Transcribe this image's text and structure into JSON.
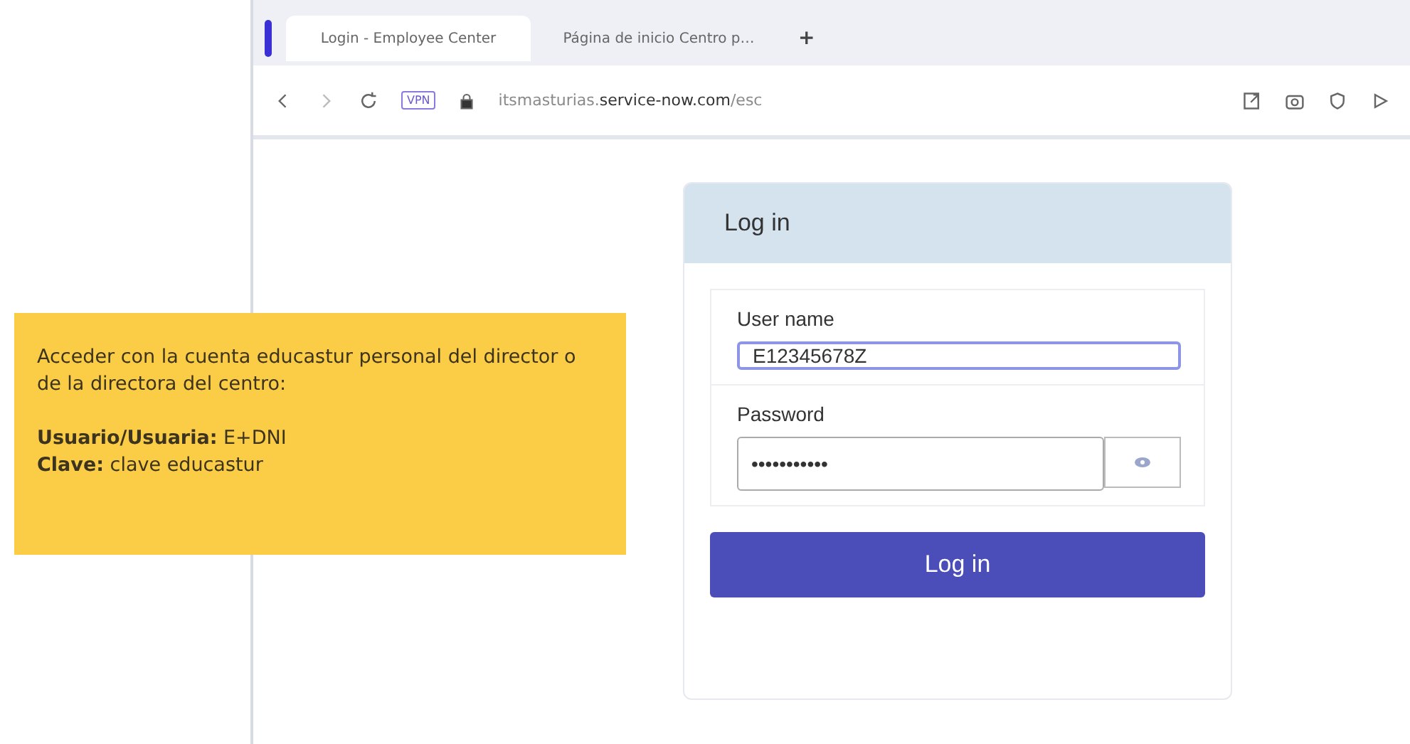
{
  "tabs": [
    {
      "label": "Login - Employee Center",
      "selected": true
    },
    {
      "label": "Página de inicio Centro p…",
      "selected": false
    }
  ],
  "new_tab": "+",
  "address_bar": {
    "vpn": "VPN",
    "url": "itsmasturias.**service-now.com**/esc"
  },
  "callout": {
    "intro": "Acceder con la cuenta educastur personal del director o de la directora del centro:",
    "lines": [
      "**Usuario/Usuaria:** E+DNI",
      "**Clave:** clave educastur"
    ]
  },
  "login": {
    "title": "Log in",
    "username": {
      "label": "User name",
      "value": "E12345678Z"
    },
    "password": {
      "label": "Password",
      "masked": "•••••••••••"
    },
    "button": "Log in"
  }
}
